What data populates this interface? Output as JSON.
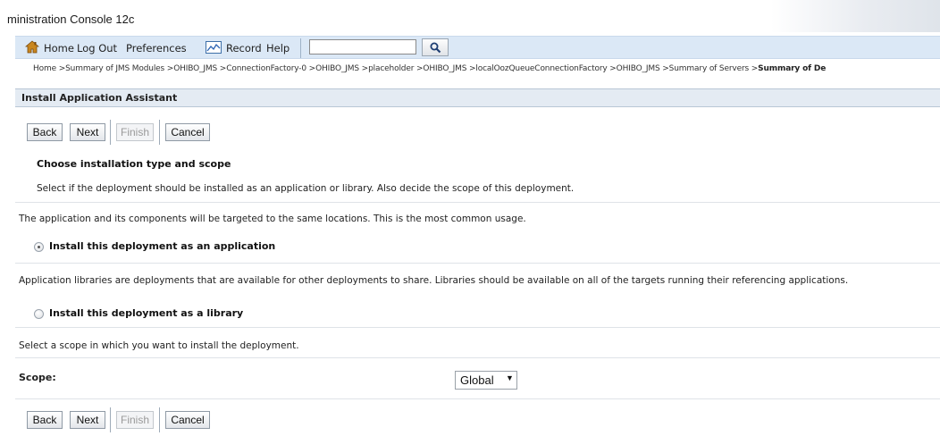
{
  "window": {
    "title": "ministration Console 12c"
  },
  "toolbar": {
    "home": "Home",
    "logout": "Log Out",
    "preferences": "Preferences",
    "record": "Record",
    "help": "Help",
    "search_value": ""
  },
  "breadcrumb": {
    "items": [
      "Home >",
      "Summary of JMS Modules >",
      "OHIBO_JMS >",
      "ConnectionFactory-0 >",
      "OHIBO_JMS >",
      "placeholder >",
      "OHIBO_JMS >",
      "localOozQueueConnectionFactory >",
      "OHIBO_JMS >",
      "Summary of Servers >"
    ],
    "current": "Summary of De"
  },
  "panel": {
    "title": "Install Application Assistant"
  },
  "buttons": {
    "back": "Back",
    "next": "Next",
    "finish": "Finish",
    "cancel": "Cancel"
  },
  "content": {
    "section_title": "Choose installation type and scope",
    "section_desc": "Select if the deployment should be installed as an application or library. Also decide the scope of this deployment.",
    "app_desc": "The application and its components will be targeted to the same locations. This is the most common usage.",
    "app_option": "Install this deployment as an application",
    "lib_desc": "Application libraries are deployments that are available for other deployments to share. Libraries should be available on all of the targets running their referencing applications.",
    "lib_option": "Install this deployment as a library",
    "scope_desc": "Select a scope in which you want to install the deployment.",
    "scope_label": "Scope:",
    "scope_value": "Global"
  }
}
